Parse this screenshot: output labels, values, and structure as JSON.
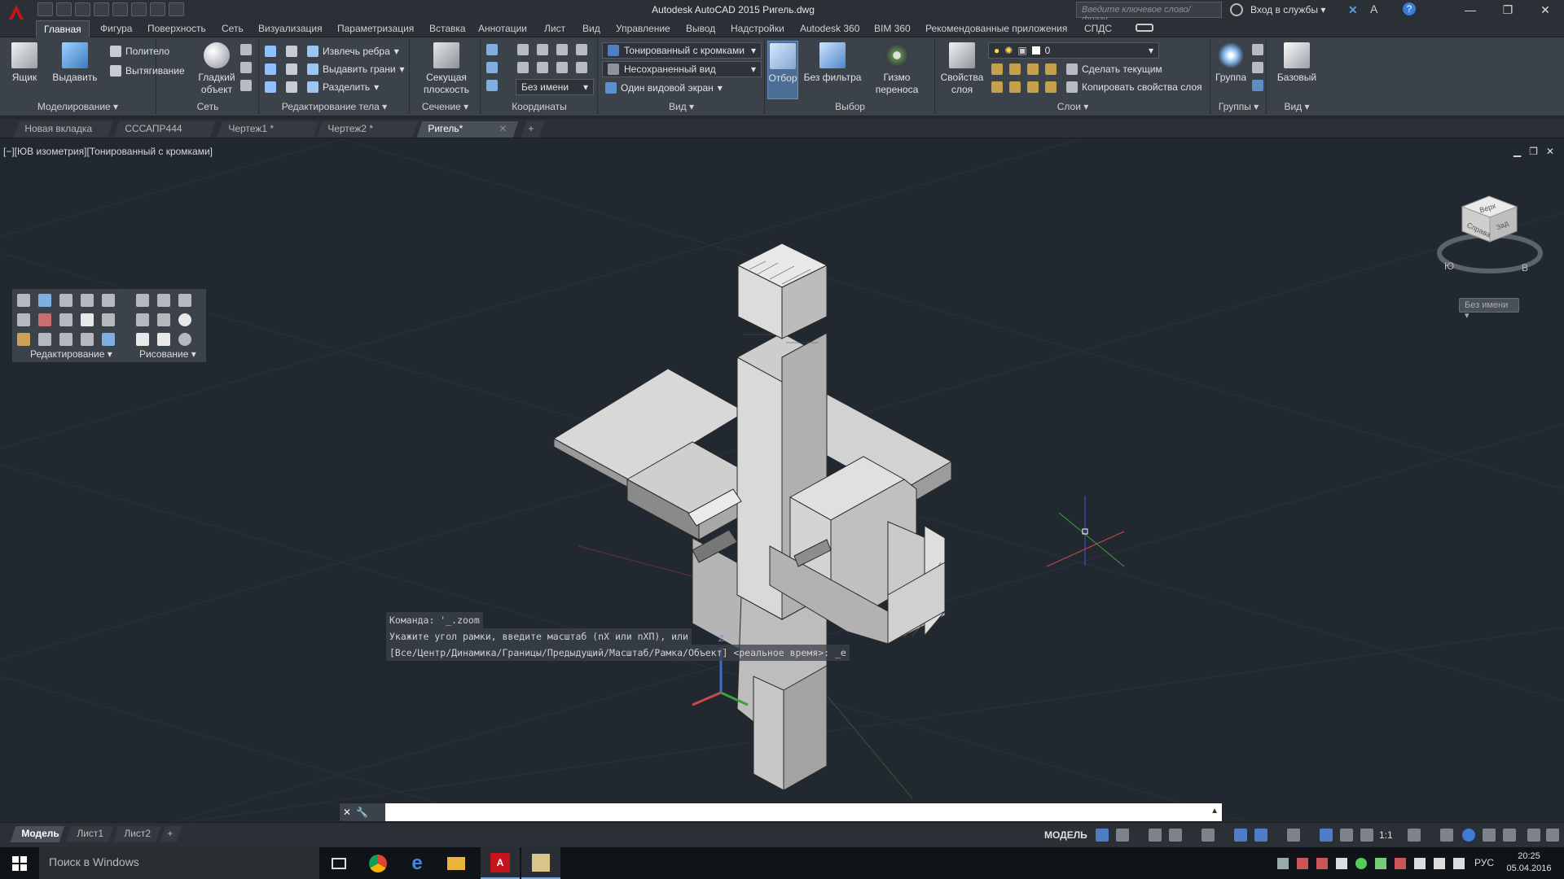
{
  "app": {
    "title": "Autodesk AutoCAD 2015   Ригель.dwg",
    "search_placeholder": "Введите ключевое слово/фразу",
    "signin_label": "Вход в службы",
    "brand_color": "#c4151c"
  },
  "menu_tabs": [
    "Главная",
    "Фигура",
    "Поверхность",
    "Сеть",
    "Визуализация",
    "Параметризация",
    "Вставка",
    "Аннотации",
    "Лист",
    "Вид",
    "Управление",
    "Вывод",
    "Надстройки",
    "Autodesk 360",
    "BIM 360",
    "Рекомендованные приложения",
    "СПДС"
  ],
  "ribbon": {
    "modeling": {
      "title": "Моделирование",
      "box": "Ящик",
      "extrude": "Выдавить",
      "polysolid": "Политело",
      "presspull": "Вытягивание"
    },
    "mesh": {
      "title": "Сеть",
      "smooth": "Гладкий\nобъект"
    },
    "solid_edit": {
      "title": "Редактирование тела",
      "extract_edges": "Извлечь ребра",
      "extrude_faces": "Выдавить грани",
      "separate": "Разделить"
    },
    "section": {
      "title": "Сечение",
      "plane": "Секущая\nплоскость"
    },
    "coords": {
      "title": "Координаты",
      "ucs_name": "Без имени"
    },
    "view": {
      "title": "Вид",
      "visual_style": "Тонированный с кромками",
      "named_view": "Несохраненный вид",
      "viewport_config": "Один видовой экран"
    },
    "selection": {
      "title": "Выбор",
      "culling": "Отбор",
      "no_filter": "Без фильтра",
      "gizmo": "Гизмо\nпереноса"
    },
    "layers": {
      "title": "Слои",
      "layer_props": "Свойства\nслоя",
      "current_layer": "0",
      "make_current": "Сделать текущим",
      "match_layer": "Копировать свойства слоя"
    },
    "groups": {
      "title": "Группы",
      "group": "Группа"
    },
    "view2": {
      "title": "Вид",
      "base": "Базовый"
    }
  },
  "doc_tabs": [
    "Новая вкладка",
    "СССАПР444",
    "Чертеж1 *",
    "Чертеж2 *",
    "Ригель*"
  ],
  "viewport": {
    "label": "[−][ЮВ изометрия][Тонированный с кромками]",
    "viewcube": {
      "top": "Верх",
      "right": "Справа",
      "back": "Зад",
      "south": "Ю",
      "east": "В",
      "ucs_name": "Без имени"
    }
  },
  "floating_toolbar": {
    "edit_title": "Редактирование",
    "draw_title": "Рисование"
  },
  "command": {
    "history": [
      "Команда: '_.zoom",
      "Укажите угол рамки, введите масштаб (nX или nXП), или",
      "[Все/Центр/Динамика/Границы/Предыдущий/Масштаб/Рамка/Объект] <реальное время>: _e"
    ],
    "input": ""
  },
  "layout_tabs": [
    "Модель",
    "Лист1",
    "Лист2"
  ],
  "status": {
    "model_space": "МОДЕЛЬ",
    "scale": "1:1"
  },
  "taskbar": {
    "search": "Поиск в Windows",
    "lang": "РУС",
    "time": "20:25",
    "date": "05.04.2016"
  }
}
